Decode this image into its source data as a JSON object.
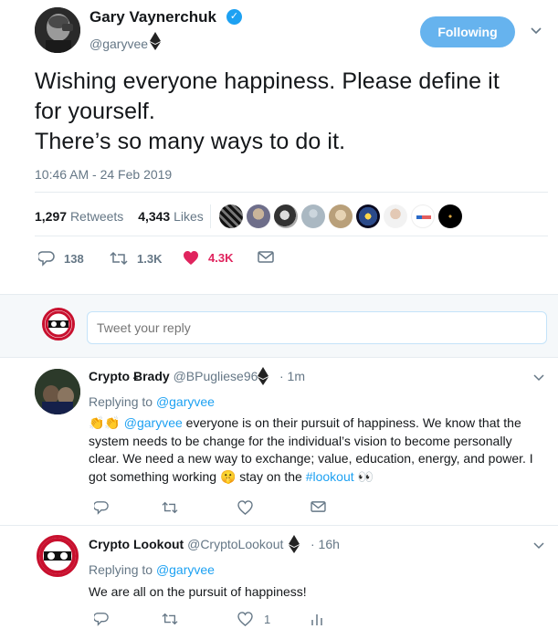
{
  "tweet": {
    "display_name": "Gary Vaynerchuk",
    "verified_icon": "verified-badge-icon",
    "handle": "@garyvee",
    "follow_label": "Following",
    "text_lines": [
      "Wishing everyone happiness. Please define it",
      "for yourself.",
      "There’s so many ways to do it."
    ],
    "timestamp": "10:46 AM - 24 Feb 2019",
    "retweets_count": "1,297",
    "retweets_label": "Retweets",
    "likes_count": "4,343",
    "likes_label": "Likes",
    "actions": {
      "reply_count": "138",
      "retweet_count": "1.3K",
      "like_count": "4.3K"
    }
  },
  "reply_box": {
    "placeholder": "Tweet your reply"
  },
  "replies": [
    {
      "name": "Crypto Ƀrady",
      "handle": "@BPugliese96",
      "time": "· 1m",
      "replying_label": "Replying to",
      "replying_to": "@garyvee",
      "text_parts": {
        "lead_emoji": "👏👏",
        "mention": "@garyvee",
        "body": " everyone is on their pursuit of happiness. We know that the system needs to be change for the individual’s vision to become personally clear. We need a new way to exchange; value, education, energy, and power. I got something working ",
        "mid_emoji": "🤫",
        "middle": " stay on the ",
        "hashtag": "#lookout",
        "end_emoji": "👀"
      },
      "actions": {
        "reply_count": "",
        "retweet_count": "",
        "like_count": ""
      }
    },
    {
      "name": "Crypto Lookout",
      "handle": "@CryptoLookout",
      "time": "· 16h",
      "replying_label": "Replying to",
      "replying_to": "@garyvee",
      "text": "We are all on the pursuit of happiness!",
      "actions": {
        "reply_count": "",
        "retweet_count": "",
        "like_count": "1"
      }
    }
  ],
  "colors": {
    "accent": "#1da1f2",
    "follow_button": "#66b3ee",
    "like_heart": "#e0245e",
    "muted_text": "#657786",
    "badge_red": "#c8102e"
  },
  "icons": {
    "reply": "reply-icon",
    "retweet": "retweet-icon",
    "like": "heart-icon",
    "dm": "envelope-icon",
    "analytics": "analytics-icon",
    "caret": "chevron-down-icon",
    "ethereum": "ethereum-icon"
  }
}
